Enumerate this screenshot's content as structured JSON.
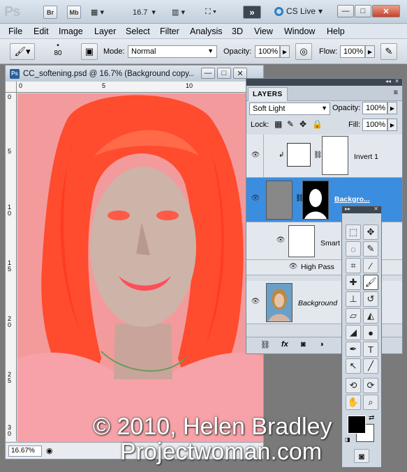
{
  "app": {
    "logo": "Ps",
    "bridge": "Br",
    "minibridge": "Mb",
    "zoom": "16.7",
    "cs_live": "CS Live",
    "window_min": "—",
    "window_restore": "□",
    "window_close": "✕"
  },
  "menu": {
    "items": [
      "File",
      "Edit",
      "Image",
      "Layer",
      "Select",
      "Filter",
      "Analysis",
      "3D",
      "View",
      "Window",
      "Help"
    ]
  },
  "options": {
    "brush_size": "80",
    "mode_label": "Mode:",
    "mode_value": "Normal",
    "opacity_label": "Opacity:",
    "opacity_value": "100%",
    "flow_label": "Flow:",
    "flow_value": "100%"
  },
  "document": {
    "title": "CC_softening.psd @ 16.7% (Background copy...",
    "zoom": "16.67%",
    "ruler_top": [
      "0",
      "5",
      "10"
    ],
    "ruler_left": [
      "0",
      "5",
      "1\n0",
      "1\n5",
      "2\n0",
      "2\n5",
      "3\n0"
    ]
  },
  "layers_panel": {
    "tab": "LAYERS",
    "blend_mode": "Soft Light",
    "opacity_label": "Opacity:",
    "opacity_value": "100%",
    "lock_label": "Lock:",
    "fill_label": "Fill:",
    "fill_value": "100%",
    "layers": [
      {
        "name": "Invert 1"
      },
      {
        "name": "Backgro..."
      },
      {
        "name": "Smart"
      },
      {
        "name": "High Pass"
      },
      {
        "name": "Background"
      }
    ]
  },
  "watermark": {
    "line1": "© 2010, Helen Bradley",
    "line2": "Projectwoman.com"
  },
  "colors": {
    "canvas": "#f39a9c",
    "selection": "#3b8de0"
  }
}
